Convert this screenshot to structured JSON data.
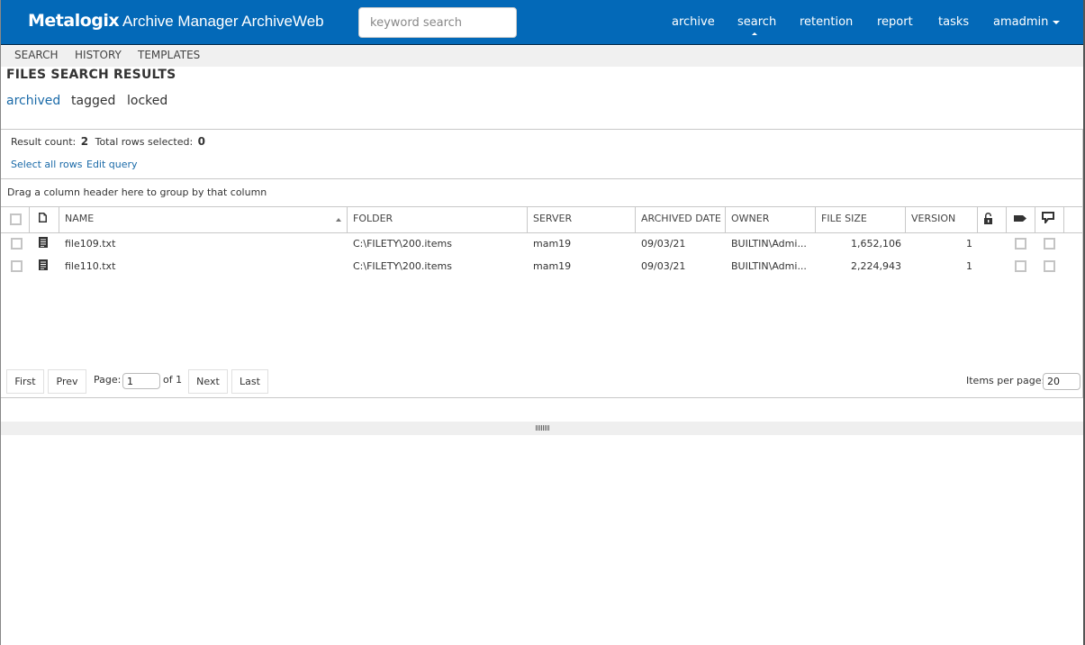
{
  "header": {
    "brand": "Metalogix",
    "app_title": "Archive Manager ArchiveWeb",
    "search_placeholder": "keyword search",
    "nav": [
      {
        "label": "archive",
        "active": false
      },
      {
        "label": "search",
        "active": true
      },
      {
        "label": "retention",
        "active": false
      },
      {
        "label": "report",
        "active": false
      },
      {
        "label": "tasks",
        "active": false
      }
    ],
    "user": "amadmin",
    "accent": "#0369b8"
  },
  "subtabs": [
    "SEARCH",
    "HISTORY",
    "TEMPLATES"
  ],
  "page": {
    "title": "FILES SEARCH RESULTS",
    "filters": [
      {
        "label": "archived",
        "active": true
      },
      {
        "label": "tagged",
        "active": false
      },
      {
        "label": "locked",
        "active": false
      }
    ]
  },
  "results": {
    "count_label": "Result count:",
    "count": "2",
    "selected_label": "Total rows selected:",
    "selected": "0",
    "select_all": "Select all rows",
    "edit_query": "Edit query",
    "group_hint": "Drag a column header here to group by that column"
  },
  "grid": {
    "columns": {
      "name": "NAME",
      "folder": "FOLDER",
      "server": "SERVER",
      "archived_date": "ARCHIVED DATE",
      "owner": "OWNER",
      "file_size": "FILE SIZE",
      "version": "VERSION"
    },
    "header_icons": [
      "file-icon",
      "lock-icon",
      "tag-icon",
      "comment-icon"
    ],
    "sort": {
      "column": "NAME",
      "direction": "ascending"
    },
    "rows": [
      {
        "name": "file109.txt",
        "folder": "C:\\FILETY\\200.items",
        "server": "mam19",
        "archived_date": "09/03/21",
        "owner": "BUILTIN\\Admi...",
        "file_size": "1,652,106",
        "version": "1"
      },
      {
        "name": "file110.txt",
        "folder": "C:\\FILETY\\200.items",
        "server": "mam19",
        "archived_date": "09/03/21",
        "owner": "BUILTIN\\Admi...",
        "file_size": "2,224,943",
        "version": "1"
      }
    ]
  },
  "pager": {
    "first": "First",
    "prev": "Prev",
    "page_label": "Page:",
    "page_value": "1",
    "of_label": "of 1",
    "next": "Next",
    "last": "Last",
    "items_label": "Items per page:",
    "items_value": "20"
  }
}
